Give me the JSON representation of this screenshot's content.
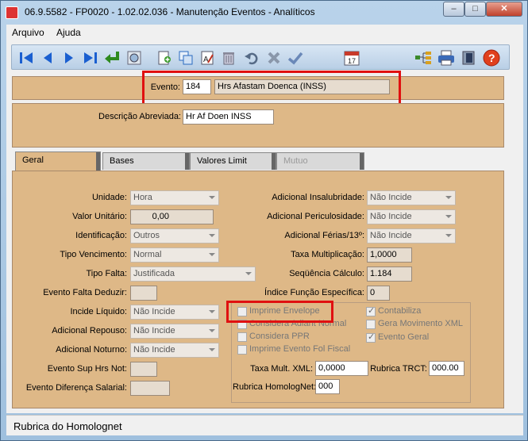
{
  "window": {
    "title": "06.9.5582 - FP0020 - 1.02.02.036 - Manutenção Eventos - Analíticos",
    "controls": {
      "minimize": "–",
      "maximize": "□",
      "close": "✕"
    }
  },
  "menu": {
    "items": [
      {
        "label": "Arquivo"
      },
      {
        "label": "Ajuda"
      }
    ]
  },
  "toolbar": {
    "icons": [
      "first-icon",
      "previous-icon",
      "next-icon",
      "last-icon",
      "enter-icon",
      "search-icon",
      "new-icon",
      "copy-icon",
      "edit-icon",
      "delete-icon",
      "undo-icon",
      "cancel-icon",
      "confirm-icon",
      "calendar-icon",
      "tree-icon",
      "print-icon",
      "exit-icon",
      "help-icon"
    ],
    "calendar_day": "17"
  },
  "evento": {
    "label": "Evento:",
    "code": "184",
    "name": "Hrs Afastam Doenca   (INSS)"
  },
  "descricao": {
    "label": "Descrição Abreviada:",
    "value": "Hr Af Doen INSS"
  },
  "tabs": [
    {
      "label": "Geral"
    },
    {
      "label": "Bases"
    },
    {
      "label": "Valores Limit"
    },
    {
      "label": "Mutuo"
    }
  ],
  "geral": {
    "left": {
      "unidade": {
        "label": "Unidade:",
        "value": "Hora"
      },
      "valor_unitario": {
        "label": "Valor Unitário:",
        "value": "0,00"
      },
      "identificacao": {
        "label": "Identificação:",
        "value": "Outros"
      },
      "tipo_vencimento": {
        "label": "Tipo Vencimento:",
        "value": "Normal"
      },
      "tipo_falta": {
        "label": "Tipo Falta:",
        "value": "Justificada"
      },
      "evento_falta_deduzir": {
        "label": "Evento Falta Deduzir:",
        "value": ""
      },
      "incide_liquido": {
        "label": "Incide Líquido:",
        "value": "Não Incide"
      },
      "adicional_repouso": {
        "label": "Adicional Repouso:",
        "value": "Não Incide"
      },
      "adicional_noturno": {
        "label": "Adicional Noturno:",
        "value": "Não Incide"
      },
      "evento_sup_hrs_not": {
        "label": "Evento Sup Hrs Not:",
        "value": ""
      },
      "evento_diferenca_salarial": {
        "label": "Evento Diferença Salarial:",
        "value": ""
      }
    },
    "right": {
      "adicional_insalubridade": {
        "label": "Adicional Insalubridade:",
        "value": "Não Incide"
      },
      "adicional_periculosidade": {
        "label": "Adicional Periculosidade:",
        "value": "Não Incide"
      },
      "adicional_ferias": {
        "label": "Adicional Férias/13º:",
        "value": "Não Incide"
      },
      "taxa_multiplicacao": {
        "label": "Taxa Multiplicação:",
        "value": "1,0000"
      },
      "sequencia_calculo": {
        "label": "Seqüência Cálculo:",
        "value": "1.184"
      },
      "indice_funcao_especifica": {
        "label": "Índice Função Específica:",
        "value": "0"
      }
    },
    "checkboxes": {
      "imprime_envelope": {
        "label": "Imprime Envelope",
        "checked": false
      },
      "considera_adiant_normal": {
        "label": "Considera Adiant Normal",
        "checked": false
      },
      "considera_ppr": {
        "label": "Considera PPR",
        "checked": false
      },
      "imprime_evento_fol_fiscal": {
        "label": "Imprime Evento Fol Fiscal",
        "checked": false
      },
      "contabiliza": {
        "label": "Contabiliza",
        "checked": true
      },
      "gera_movimento_xml": {
        "label": "Gera Movimento XML",
        "checked": false
      },
      "evento_geral": {
        "label": "Evento Geral",
        "checked": true
      }
    },
    "taxa_mult_xml": {
      "label": "Taxa Mult. XML:",
      "value": "0,0000"
    },
    "rubrica_trct": {
      "label": "Rubrica TRCT:",
      "value": "000.00"
    },
    "rubrica_homolognet": {
      "label": "Rubrica HomologNet:",
      "value": "000"
    }
  },
  "status": {
    "text": "Rubrica do Homolognet"
  },
  "colors": {
    "panel": "#deb887",
    "highlight": "#e01010",
    "toolbar": "#c8daee"
  }
}
